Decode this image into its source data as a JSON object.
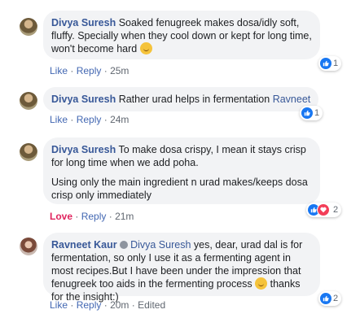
{
  "comments": [
    {
      "author": "Divya Suresh",
      "text": " Soaked fenugreek makes dosa/idly soft, fluffy. Specially when they cool down or kept for long time, won't become hard ",
      "actions": {
        "like": "Like",
        "reply": "Reply",
        "time": "25m"
      },
      "reaction_count": "1"
    },
    {
      "author": "Divya Suresh",
      "text": " Rather urad helps in fermentation ",
      "mention": "Ravneet",
      "actions": {
        "like": "Like",
        "reply": "Reply",
        "time": "24m"
      },
      "reaction_count": "1"
    },
    {
      "author": "Divya Suresh",
      "text": " To make dosa crispy, I mean it stays crisp for long time when we add poha.",
      "text2": "Using only the main ingredient n urad makes/keeps dosa crisp only immediately",
      "actions": {
        "like": "Love",
        "reply": "Reply",
        "time": "21m"
      },
      "reaction_count": "2"
    },
    {
      "author": "Ravneet Kaur",
      "mention": "Divya Suresh",
      "text": " yes, dear, urad dal is for fermentation, so only I use it as a fermenting agent in most recipes.But I have been under the impression that fenugreek too aids in the fermenting process ",
      "text_end": " thanks for the insight:)",
      "actions": {
        "like": "Like",
        "reply": "Reply",
        "time": "20m",
        "edited": "Edited"
      },
      "reaction_count": "2"
    }
  ],
  "icons": {
    "like": "thumbs-up-icon",
    "love": "heart-icon",
    "badge": "top-fan-badge-icon",
    "smile": "smile-emoji-icon"
  },
  "colors": {
    "name": "#385898",
    "link": "#4267b2",
    "love": "#e0245e",
    "bubble": "#f2f3f5",
    "like_reaction": "#1877f2",
    "heart_reaction": "#f33e58"
  },
  "separator": "·"
}
